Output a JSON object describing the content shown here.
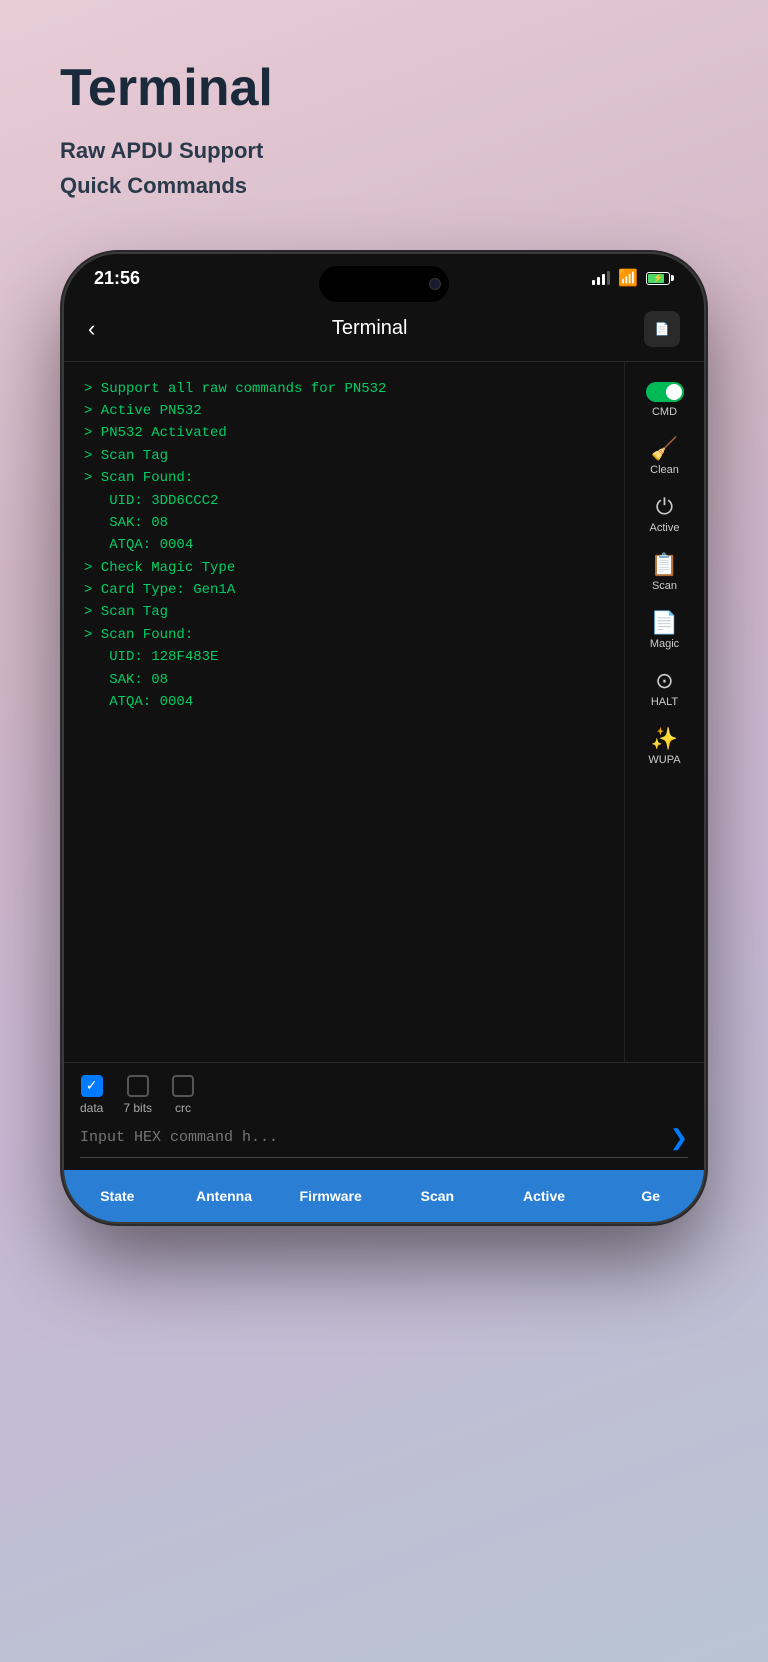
{
  "header": {
    "title": "Terminal",
    "subtitle_line1": "Raw APDU Support",
    "subtitle_line2": "Quick Commands"
  },
  "status_bar": {
    "time": "21:56",
    "signal_level": 3,
    "wifi": true,
    "battery_percent": 80,
    "charging": true
  },
  "nav": {
    "back_label": "‹",
    "title": "Terminal",
    "pdf_label": "PDF"
  },
  "terminal": {
    "lines": [
      "> Support all raw commands for PN532",
      "> Active PN532",
      "> PN532 Activated",
      "> Scan Tag",
      "> Scan Found:",
      "   UID: 3DD6CCC2",
      "   SAK: 08",
      "   ATQA: 0004",
      "> Check Magic Type",
      "> Card Type: Gen1A",
      "> Scan Tag",
      "> Scan Found:",
      "   UID: 128F483E",
      "   SAK: 08",
      "   ATQA: 0004"
    ]
  },
  "sidebar_buttons": [
    {
      "id": "cmd",
      "label": "CMD",
      "icon_type": "toggle",
      "toggle_on": true
    },
    {
      "id": "clean",
      "label": "Clean",
      "icon_type": "clean"
    },
    {
      "id": "active",
      "label": "Active",
      "icon_type": "power"
    },
    {
      "id": "scan",
      "label": "Scan",
      "icon_type": "scan"
    },
    {
      "id": "magic",
      "label": "Magic",
      "icon_type": "magic"
    },
    {
      "id": "halt",
      "label": "HALT",
      "icon_type": "halt"
    },
    {
      "id": "wupa",
      "label": "WUPA",
      "icon_type": "wupa"
    }
  ],
  "input_area": {
    "checkboxes": [
      {
        "id": "data",
        "label": "data",
        "checked": true
      },
      {
        "id": "7bits",
        "label": "7 bits",
        "checked": false
      },
      {
        "id": "crc",
        "label": "crc",
        "checked": false
      }
    ],
    "placeholder": "Input HEX command h..."
  },
  "tab_bar": {
    "tabs": [
      {
        "id": "state",
        "label": "State",
        "active": false
      },
      {
        "id": "antenna",
        "label": "Antenna",
        "active": false
      },
      {
        "id": "firmware",
        "label": "Firmware",
        "active": false
      },
      {
        "id": "scan",
        "label": "Scan",
        "active": false
      },
      {
        "id": "active",
        "label": "Active",
        "active": false
      },
      {
        "id": "ge",
        "label": "Ge",
        "active": false
      }
    ]
  }
}
